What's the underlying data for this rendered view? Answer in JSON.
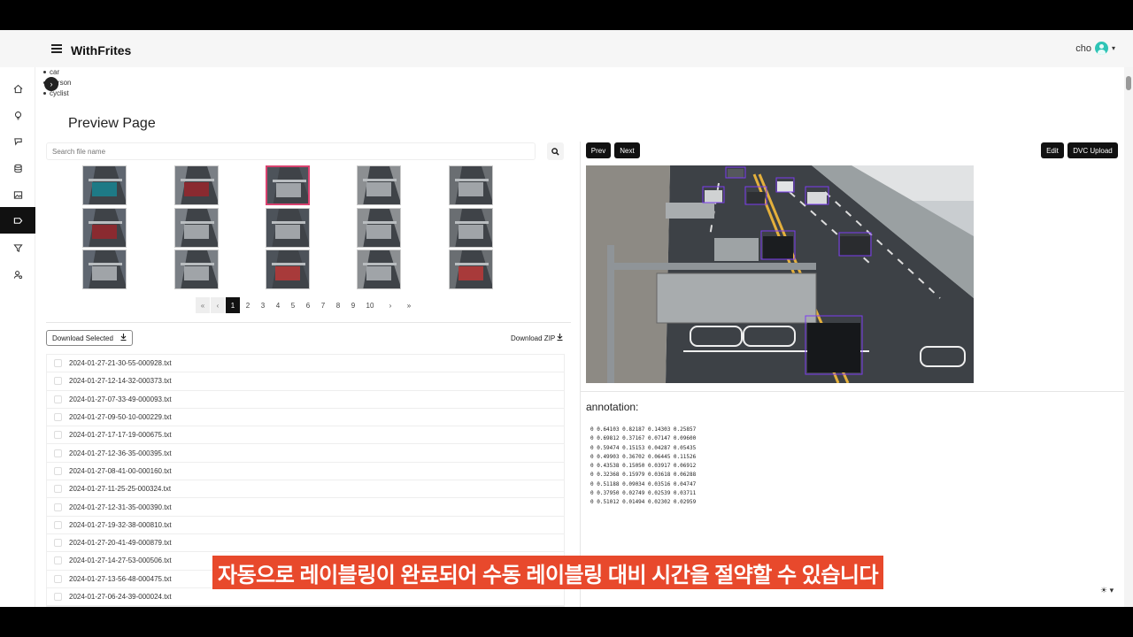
{
  "app": {
    "brand": "WithFrites",
    "user": "cho"
  },
  "legend": {
    "items": [
      "car",
      "person",
      "cyclist"
    ]
  },
  "page": {
    "title": "Preview Page"
  },
  "search": {
    "placeholder": "Search file name"
  },
  "pagination": {
    "first": "«",
    "prev": "‹",
    "pages": [
      "1",
      "2",
      "3",
      "4",
      "5",
      "6",
      "7",
      "8",
      "9",
      "10"
    ],
    "active": "1",
    "next": "›",
    "last": "»"
  },
  "downloads": {
    "selected_label": "Download Selected",
    "zip_label": "Download ZIP"
  },
  "files": [
    "2024-01-27-21-30-55-000928.txt",
    "2024-01-27-12-14-32-000373.txt",
    "2024-01-27-07-33-49-000093.txt",
    "2024-01-27-09-50-10-000229.txt",
    "2024-01-27-17-17-19-000675.txt",
    "2024-01-27-12-36-35-000395.txt",
    "2024-01-27-08-41-00-000160.txt",
    "2024-01-27-11-25-25-000324.txt",
    "2024-01-27-12-31-35-000390.txt",
    "2024-01-27-19-32-38-000810.txt",
    "2024-01-27-20-41-49-000879.txt",
    "2024-01-27-14-27-53-000506.txt",
    "2024-01-27-13-56-48-000475.txt",
    "2024-01-27-06-24-39-000024.txt"
  ],
  "viewer": {
    "prev": "Prev",
    "next": "Next",
    "edit": "Edit",
    "dvc_upload": "DVC Upload"
  },
  "annotation": {
    "title": "annotation:",
    "lines": [
      "0 0.64103 0.82187 0.14303 0.25857",
      "0 0.69812 0.37167 0.07147 0.09600",
      "0 0.59474 0.15153 0.04287 0.05435",
      "0 0.49903 0.36702 0.06445 0.11526",
      "0 0.43538 0.15050 0.03917 0.06912",
      "0 0.32368 0.15979 0.03618 0.06288",
      "0 0.51188 0.09034 0.03516 0.04747",
      "0 0.37950 0.02749 0.02539 0.03711",
      "0 0.51012 0.01494 0.02302 0.02959"
    ]
  },
  "subtitle": "자동으로 레이블링이 완료되어 수동 레이블링 대비 시간을 절약할 수 있습니다",
  "icons": {
    "sidebar": [
      "home-icon",
      "bulb-icon",
      "git-icon",
      "database-icon",
      "image-icon",
      "label-icon",
      "filter-icon",
      "user-search-icon"
    ],
    "search": "search-icon",
    "download": "download-icon",
    "theme": "sun-icon"
  },
  "colors": {
    "accent_dark": "#111111",
    "selected_border": "#d8426f",
    "subtitle_bg": "#e8492c",
    "avatar": "#2ec4b6"
  }
}
